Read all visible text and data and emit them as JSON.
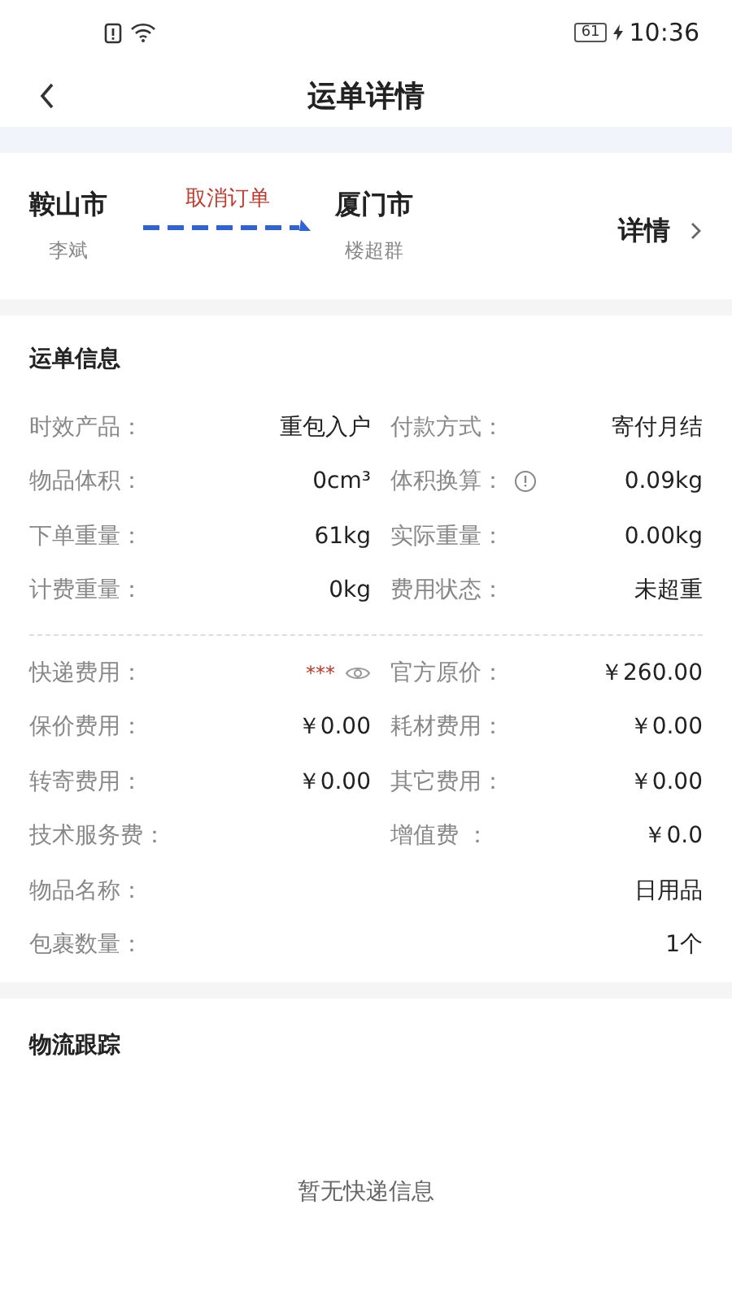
{
  "status_bar": {
    "battery": "61",
    "time": "10:36"
  },
  "header": {
    "title": "运单详情"
  },
  "route": {
    "from": {
      "city": "鞍山市",
      "name": "李斌"
    },
    "status": "取消订单",
    "to": {
      "city": "厦门市",
      "name": "楼超群"
    },
    "detail": "详情"
  },
  "waybill_info": {
    "title": "运单信息",
    "groups": [
      [
        {
          "cells": [
            {
              "label": "时效产品：",
              "value": "重包入户"
            },
            {
              "label": "付款方式：",
              "value": "寄付月结"
            }
          ]
        },
        {
          "cells": [
            {
              "label": "物品体积：",
              "value": "0cm³"
            },
            {
              "label": "体积换算：",
              "value": "0.09kg",
              "kind": "info"
            }
          ]
        },
        {
          "cells": [
            {
              "label": "下单重量：",
              "value": "61kg"
            },
            {
              "label": "实际重量：",
              "value": "0.00kg"
            }
          ]
        },
        {
          "cells": [
            {
              "label": "计费重量：",
              "value": "0kg"
            },
            {
              "label": "费用状态：",
              "value": "未超重"
            }
          ]
        }
      ],
      [
        {
          "cells": [
            {
              "label": "快递费用：",
              "value": "***",
              "kind": "eye",
              "masked": true
            },
            {
              "label": "官方原价：",
              "value": "￥260.00"
            }
          ]
        },
        {
          "cells": [
            {
              "label": "保价费用：",
              "value": "￥0.00"
            },
            {
              "label": "耗材费用：",
              "value": "￥0.00"
            }
          ]
        },
        {
          "cells": [
            {
              "label": "转寄费用：",
              "value": "￥0.00"
            },
            {
              "label": "其它费用：",
              "value": "￥0.00"
            }
          ]
        },
        {
          "cells": [
            {
              "label": "技术服务费："
            },
            {
              "label": "增值费 ：",
              "value": "￥0.0"
            }
          ]
        },
        {
          "cells": [
            {
              "label": "物品名称：",
              "value": "日用品"
            }
          ]
        },
        {
          "cells": [
            {
              "label": "包裹数量：",
              "value": "1个"
            }
          ]
        }
      ]
    ]
  },
  "tracking": {
    "title": "物流跟踪",
    "empty": "暂无快递信息"
  }
}
